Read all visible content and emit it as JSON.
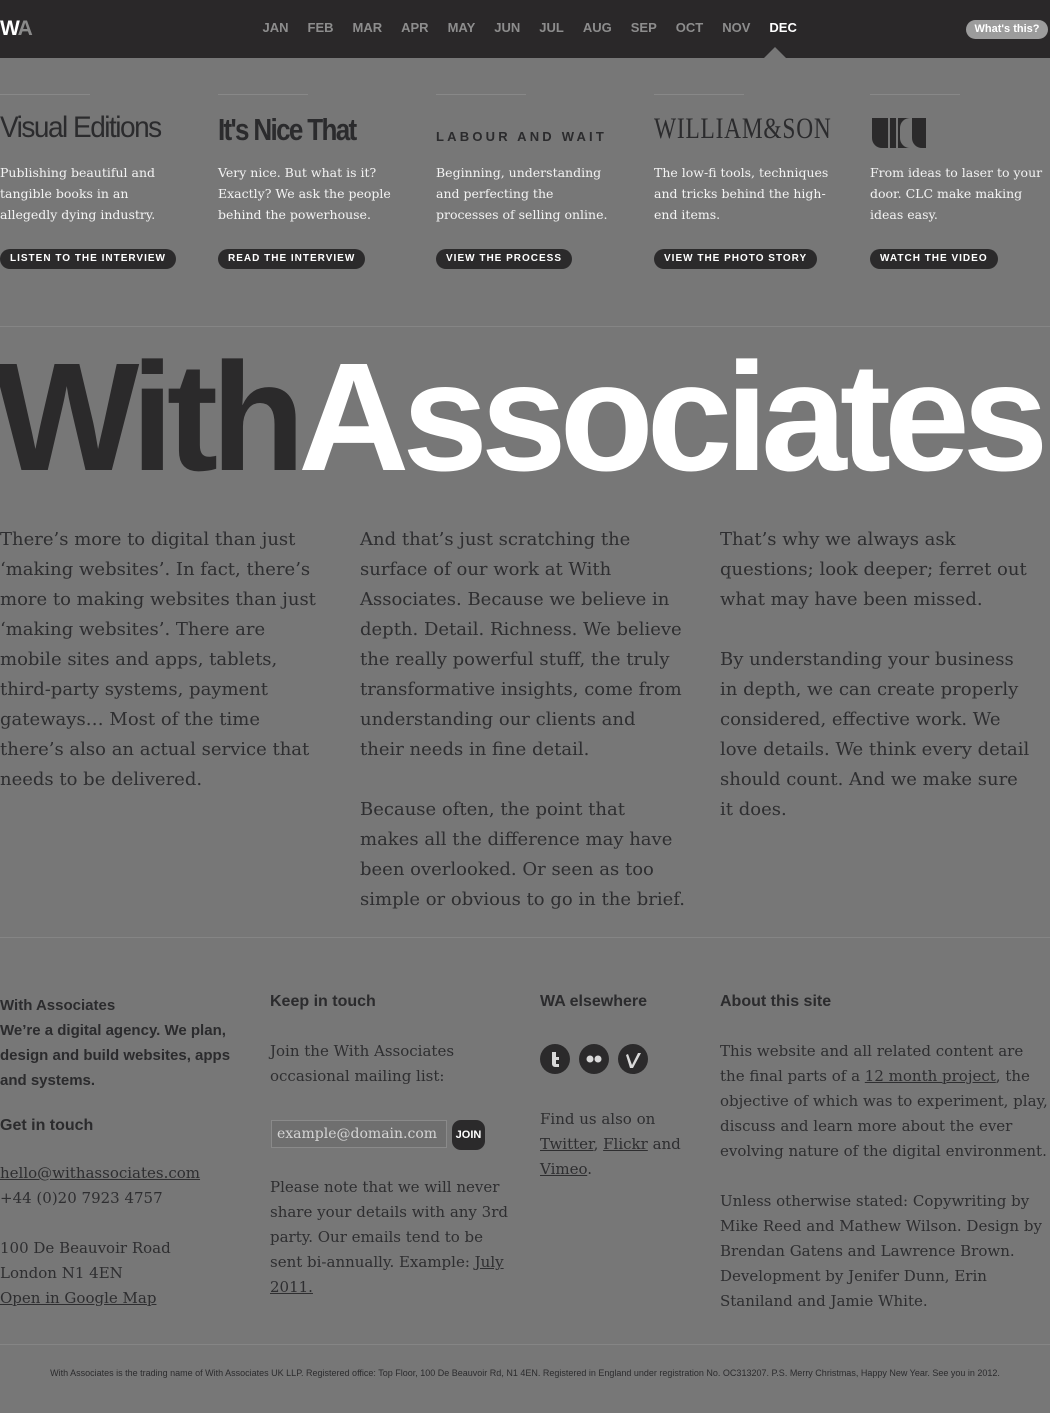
{
  "header": {
    "logo_w": "W",
    "logo_a": "A",
    "months": [
      "JAN",
      "FEB",
      "MAR",
      "APR",
      "MAY",
      "JUN",
      "JUL",
      "AUG",
      "SEP",
      "OCT",
      "NOV",
      "DEC"
    ],
    "active_month": "DEC",
    "whats_this": "What's this?"
  },
  "features": [
    {
      "brand": "Visual Editions",
      "description": "Publishing beautiful and tangible books in an allegedly dying industry.",
      "cta": "LISTEN TO THE INTERVIEW"
    },
    {
      "brand": "It's Nice That",
      "description": "Very nice. But what is it? Exactly? We ask the people behind the powerhouse.",
      "cta": "READ THE INTERVIEW"
    },
    {
      "brand": "LABOUR AND WAIT",
      "description": "Beginning, understanding and perfecting the processes of selling online.",
      "cta": "VIEW THE PROCESS"
    },
    {
      "brand": "WILLIAM&SON",
      "description": "The low-fi tools, techniques and tricks behind the high-end items.",
      "cta": "VIEW THE PHOTO STORY"
    },
    {
      "brand": "CLC",
      "description": "From ideas to laser to your door. CLC make making ideas easy.",
      "cta": "WATCH THE VIDEO"
    }
  ],
  "hero": {
    "part1": "With",
    "part2": "Associates"
  },
  "intro": {
    "col1": [
      "There’s more to digital than just ‘making websites’. In fact, there’s more to making websites than just ‘making websites’. There are mobile sites and apps, tablets, third-party systems, payment gateways… Most of the time there’s also an actual service that needs to be delivered."
    ],
    "col2": [
      "And that’s just scratching the surface of our work at With Associates. Because we believe in depth. Detail. Richness. We believe the really powerful stuff, the truly transformative insights, come from understanding our clients and their needs in fine detail.",
      "Because often, the point that makes all the difference may have been overlooked. Or seen as too simple or obvious to go in the brief."
    ],
    "col3": [
      "That’s why we always ask questions; look deeper; ferret out what may have been missed.",
      "By understanding your business in depth, we can create properly considered, effective work. We love details. We think every detail should count. And we make sure it does."
    ]
  },
  "footer": {
    "company": {
      "name": "With Associates",
      "tagline": "We’re a digital agency. We plan, design and build websites, apps and systems.",
      "contact_heading": "Get in touch",
      "email": "hello@withassociates.com",
      "phone": "+44 (0)20 7923 4757",
      "address_line1": "100 De Beauvoir Road",
      "address_line2": "London N1 4EN",
      "map_link": "Open in Google Map"
    },
    "newsletter": {
      "heading": "Keep in touch",
      "intro": "Join the With Associates occasional mailing list:",
      "placeholder": "example@domain.com",
      "join": "JOIN",
      "note": "Please note that we will never share your details with any 3rd party. Our emails tend to be sent bi-annually. Example:",
      "example_link": "July 2011."
    },
    "elsewhere": {
      "heading": "WA elsewhere",
      "icons": [
        "twitter-icon",
        "flickr-icon",
        "vimeo-icon"
      ],
      "text_prefix": "Find us also on",
      "twitter": "Twitter",
      "sep": ",",
      "flickr": "Flickr",
      "and": "and",
      "vimeo": "Vimeo",
      "end": "."
    },
    "about": {
      "heading": "About this site",
      "p1_before": "This website and all related content are the final parts of a",
      "p1_link": "12 month project",
      "p1_after": ", the objective of which was to experiment, play, discuss and learn more about the ever evolving nature of the digital environment.",
      "p2": "Unless otherwise stated: Copywriting by Mike Reed and Mathew Wilson. Design by Brendan Gatens and Lawrence Brown. Development by Jenifer Dunn, Erin Staniland and Jamie White."
    },
    "legal": "With Associates is the trading name of With Associates UK LLP. Registered office: Top Floor, 100 De Beauvoir Rd, N1 4EN. Registered in England under registration No. OC313207. P.S. Merry Christmas, Happy New Year. See you in 2012."
  },
  "colors": {
    "background": "#777777",
    "topbar": "#2a2829",
    "dark": "#2b2a2b",
    "white": "#ffffff"
  }
}
